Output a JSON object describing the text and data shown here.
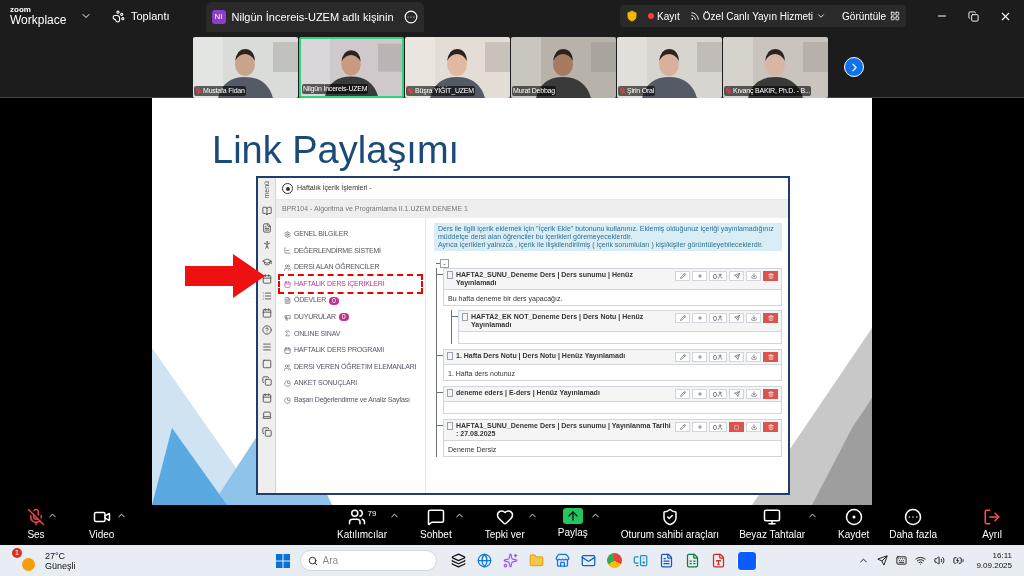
{
  "top_bar": {
    "logo_top": "zoom",
    "logo_bottom": "Workplace",
    "menu": "Toplantı",
    "tab": {
      "avatar": "NI",
      "title": "Nilgün İncereis-UZEM adlı kişinin"
    },
    "recording": "Kayıt",
    "live_stream": "Özel Canlı Yayın Hizmeti",
    "view": "Görüntüle"
  },
  "participants": [
    {
      "name": "Mustafa Fidan",
      "muted": true,
      "selected": false
    },
    {
      "name": "Nilgün İncereis-UZEM",
      "muted": false,
      "selected": true
    },
    {
      "name": "Büşra YİĞİT_UZEM",
      "muted": true,
      "selected": false
    },
    {
      "name": "Murat Debbag",
      "muted": false,
      "selected": false
    },
    {
      "name": "Şirin Oral",
      "muted": true,
      "selected": false
    },
    {
      "name": "Kıvanç BAKIR, Ph.D. - B...",
      "muted": true,
      "selected": false
    }
  ],
  "slide": {
    "title": "Link Paylaşımı",
    "app": {
      "side_label": "menü",
      "header": "Haftalık İçerik İşlemleri -",
      "course": "BPR104 - Algoritma ve Programlama II.1.UZEM DENEME 1",
      "menu": [
        {
          "label": "GENEL BİLGİLER",
          "selected": false
        },
        {
          "label": "DEĞERLENDİRME SİSTEMİ",
          "selected": false
        },
        {
          "label": "DERSİ ALAN ÖĞRENCİLER",
          "selected": false
        },
        {
          "label": "HAFTALIK DERS İÇERİKLERİ",
          "selected": true
        },
        {
          "label": "ÖDEVLER",
          "selected": false,
          "badge": "0"
        },
        {
          "label": "DUYURULAR",
          "selected": false,
          "badge": "0"
        },
        {
          "label": "ONLINE SINAV",
          "selected": false
        },
        {
          "label": "HAFTALIK DERS PROGRAMI",
          "selected": false
        },
        {
          "label": "DERSİ VEREN ÖĞRETİM ELEMANLARI",
          "selected": false
        },
        {
          "label": "ANKET SONUÇLARI",
          "selected": false
        },
        {
          "label": "Başarı Değerlendirme ve Analiz Sayfası",
          "selected": false
        }
      ],
      "info": [
        "Ders ile ilgili içerik eklemek için \"İçerik Ekle\" butonunu kullanınız. Eklemiş olduğunuz içeriği yayınlamadığınız müddetçe dersi alan öğrenciler bu içerikleri göremeyeceklerdir.",
        "Ayrıca içerikleri yalnızca , içerik ile ilişkilendirilmiş ( içerik sorumluları ) kişi/kişiler görüntüleyebileceklerdir."
      ],
      "collapse": "-",
      "contents": [
        {
          "title": "HAFTA2_SUNU_Deneme Ders | Ders sunumu | Henüz Yayınlamadı",
          "body": "Bu hafta deneme bir ders yapacağız.",
          "published": false,
          "count": "0",
          "children": [
            {
              "title": "HAFTA2_EK NOT_Deneme Ders | Ders Notu | Henüz Yayınlamadı",
              "published": false,
              "count": "0"
            }
          ]
        },
        {
          "title": "1. Hafta Ders Notu | Ders Notu | Henüz Yayınlamadı",
          "body": "1. Hafta ders notunuz",
          "published": false,
          "count": "0"
        },
        {
          "title": "deneme eders | E-ders | Henüz Yayınlamadı",
          "published": false,
          "count": "0"
        },
        {
          "title": "HAFTA1_SUNU_Deneme Ders | Ders sunumu | Yayınlanma Tarihi : 27.08.2025",
          "body": "Deneme Dersiz",
          "published": true,
          "count": "0"
        }
      ]
    }
  },
  "toolbar": [
    {
      "kind": "audio",
      "label": "Ses",
      "muted": true,
      "menu": true
    },
    {
      "kind": "video",
      "label": "Video",
      "menu": true
    },
    {
      "kind": "participants",
      "label": "Katılımcılar",
      "count": "79",
      "menu": true
    },
    {
      "kind": "chat",
      "label": "Sohbet",
      "menu": true
    },
    {
      "kind": "react",
      "label": "Tepki ver",
      "menu": true
    },
    {
      "kind": "share",
      "label": "Paylaş",
      "menu": true
    },
    {
      "kind": "host",
      "label": "Oturum sahibi araçları",
      "menu": false
    },
    {
      "kind": "whiteboard",
      "label": "Beyaz Tahtalar",
      "menu": true
    },
    {
      "kind": "record",
      "label": "Kaydet",
      "menu": false
    },
    {
      "kind": "more",
      "label": "Daha fazla",
      "menu": false
    }
  ],
  "leave": "Ayrıl",
  "taskbar": {
    "weather_badge": "1",
    "temperature": "27°C",
    "weather": "Güneşli",
    "search_placeholder": "Ara",
    "time": "16:11",
    "date": "9.09.2025"
  }
}
